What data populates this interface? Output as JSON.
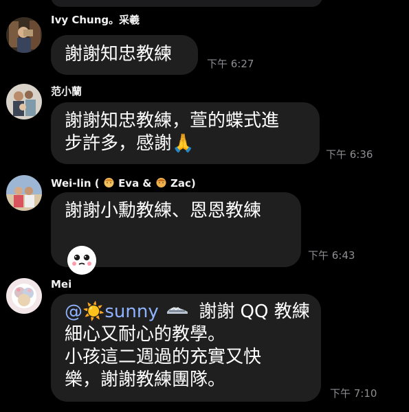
{
  "messages": [
    {
      "sender": "Ivy Chung。采羲",
      "text_lines": [
        "謝謝知忠教練"
      ],
      "time": "下午 6:27"
    },
    {
      "sender": "范小蘭",
      "text_lines": [
        "謝謝知忠教練，萱的蝶式進",
        "步許多，感謝🙏"
      ],
      "time": "下午 6:36"
    },
    {
      "sender_prefix": "Wei-lin (",
      "sender_eva": "Eva &",
      "sender_zac": "Zac)",
      "text_lines": [
        "謝謝小勳教練、恩恩教練"
      ],
      "time": "下午 6:43",
      "has_sticker": true
    },
    {
      "sender": "Mei",
      "mention": "@☀️sunny",
      "first_line_rest": "謝謝 QQ 教練",
      "text_lines": [
        "細心又耐心的教學。",
        "小孩這二週過的充實又快",
        "樂，謝謝教練團隊。"
      ],
      "time": "下午 7:10"
    }
  ],
  "colors": {
    "background": "#000000",
    "bubble": "#1f1f1f",
    "timestamp": "#8e8e93",
    "mention": "#8fb3ff"
  }
}
